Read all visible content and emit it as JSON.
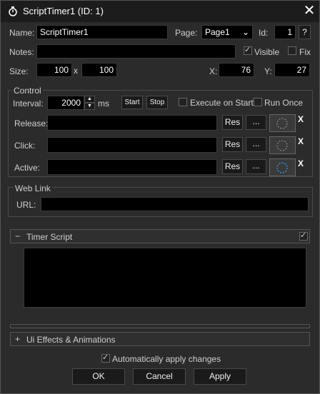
{
  "window": {
    "title": "ScriptTimer1 (ID: 1)"
  },
  "props": {
    "name_label": "Name:",
    "name_value": "ScriptTimer1",
    "page_label": "Page:",
    "page_value": "Page1",
    "id_label": "Id:",
    "id_value": "1",
    "help": "?",
    "notes_label": "Notes:",
    "notes_value": "",
    "visible_label": "Visible",
    "visible_checked": true,
    "fix_label": "Fix",
    "fix_checked": false,
    "size_label": "Size:",
    "width": "100",
    "x_sep": "x",
    "height": "100",
    "x_label": "X:",
    "x_value": "76",
    "y_label": "Y:",
    "y_value": "27"
  },
  "control": {
    "title": "Control",
    "interval_label": "Interval:",
    "interval_value": "2000",
    "ms": "ms",
    "start": "Start",
    "stop": "Stop",
    "execute_on_start": "Execute on Start",
    "run_once": "Run Once",
    "rows": [
      {
        "label": "Release:",
        "res": "Res",
        "more": "...",
        "x": "X"
      },
      {
        "label": "Click:",
        "res": "Res",
        "more": "...",
        "x": "X"
      },
      {
        "label": "Active:",
        "res": "Res",
        "more": "...",
        "x": "X"
      }
    ]
  },
  "weblink": {
    "title": "Web Link",
    "url_label": "URL:",
    "url_value": ""
  },
  "timer_script": {
    "toggle": "−",
    "title": "Timer Script",
    "checked": true
  },
  "effects": {
    "toggle": "+",
    "title": "Ui Effects & Animations"
  },
  "footer": {
    "auto_apply": "Automatically apply changes",
    "auto_checked": true,
    "ok": "OK",
    "cancel": "Cancel",
    "apply": "Apply"
  }
}
